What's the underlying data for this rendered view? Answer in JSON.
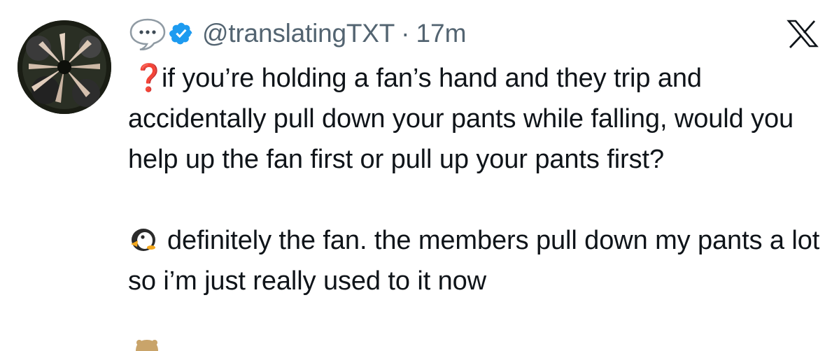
{
  "tweet": {
    "handle": "@translatingTXT",
    "separator": "·",
    "time": "17m",
    "question_emoji": "❓",
    "question": "if you’re holding a fan’s hand and they trip and accidentally pull down your pants while falling, would you help up the fan first or pull up your pants first?",
    "answer": "definitely the fan. the members pull down my pants a lot so i’m just really used to it now",
    "icons": {
      "reply_prefix": "speech-bubble-icon",
      "verified": "verified-badge-icon",
      "platform": "x-logo-icon",
      "answer_prefix": "penguin-icon"
    },
    "colors": {
      "verified": "#1d9bf0",
      "meta_text": "#536471",
      "body_text": "#0f1419",
      "question_mark": "#dd2e44"
    }
  }
}
